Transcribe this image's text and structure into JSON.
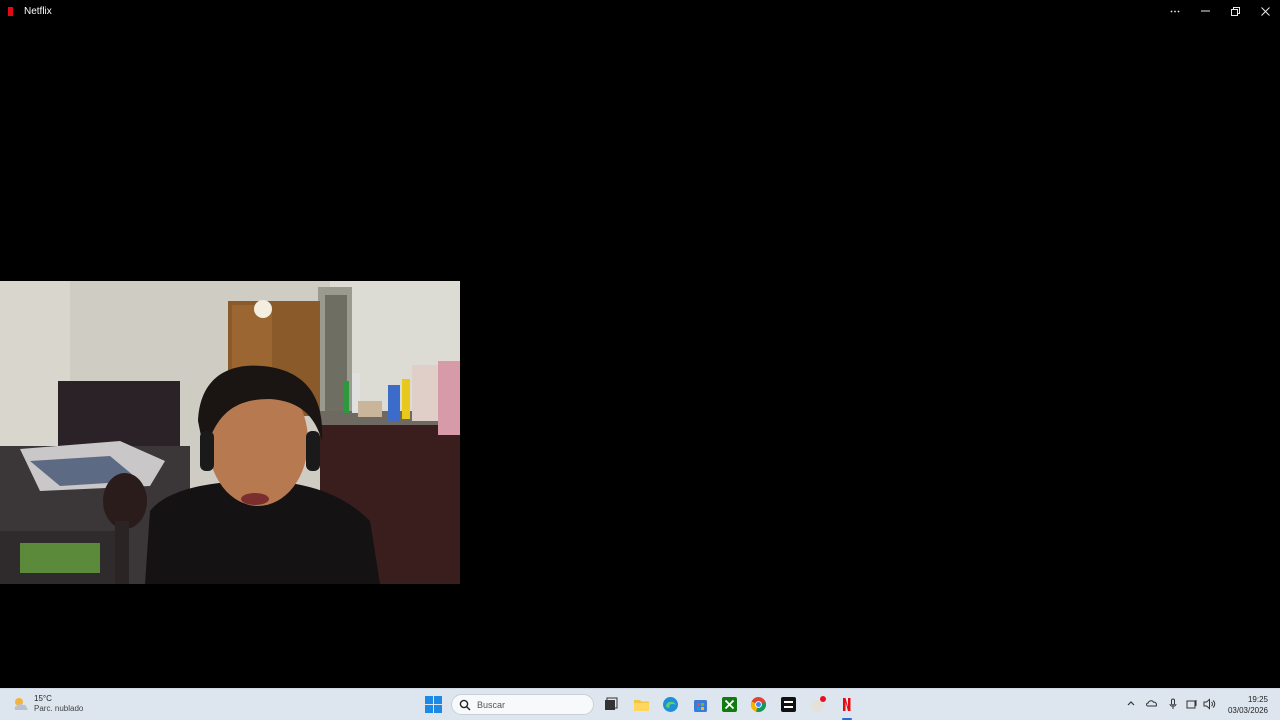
{
  "window": {
    "title": "Netflix",
    "controls": [
      "...",
      "minimize",
      "restore",
      "close"
    ],
    "accent": "#e50914"
  },
  "taskbar": {
    "weather": {
      "temp": "15°C",
      "condition": "Parc. nublado",
      "icon": "partly-cloudy-icon"
    },
    "search": {
      "placeholder": "Buscar"
    },
    "apps": [
      {
        "name": "task-view",
        "icon": "task-view-icon"
      },
      {
        "name": "file-explorer",
        "icon": "folder-icon"
      },
      {
        "name": "edge",
        "icon": "edge-icon"
      },
      {
        "name": "microsoft-store",
        "icon": "store-icon"
      },
      {
        "name": "xbox",
        "icon": "xbox-icon"
      },
      {
        "name": "chrome",
        "icon": "chrome-icon"
      },
      {
        "name": "capcut",
        "icon": "app-icon"
      },
      {
        "name": "app-badge",
        "icon": "app-icon"
      },
      {
        "name": "netflix",
        "icon": "netflix-icon",
        "active": true
      }
    ],
    "clock": {
      "time": "19:25",
      "date": "03/03/2026"
    }
  }
}
